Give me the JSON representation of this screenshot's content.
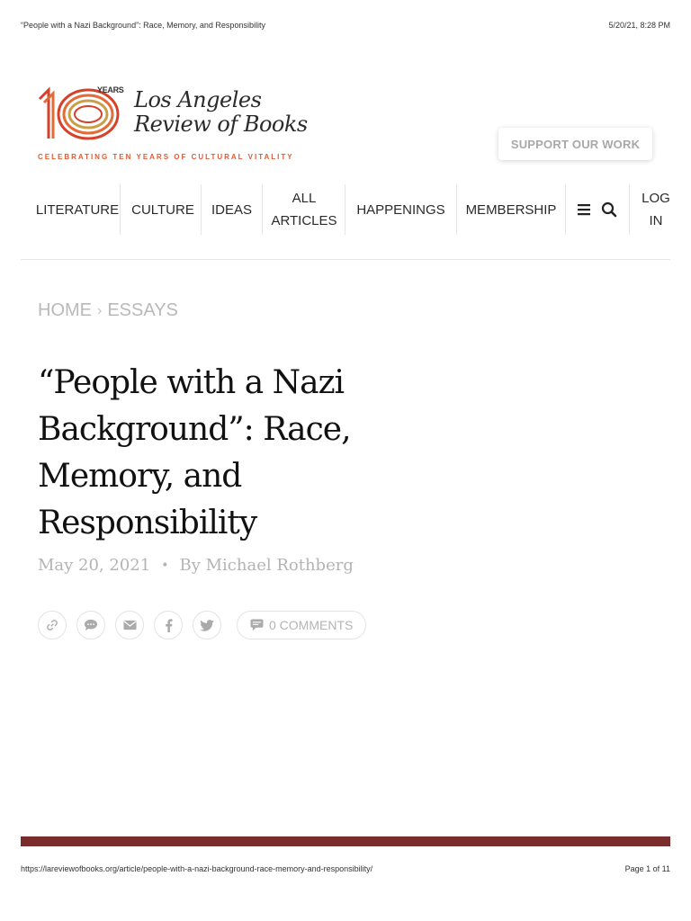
{
  "print_header": {
    "title": "“People with a Nazi Background”: Race, Memory, and Responsibility",
    "datetime": "5/20/21, 8:28 PM"
  },
  "logo": {
    "years_label": "YEARS",
    "name_line1": "Los Angeles",
    "name_line2": "Review of Books",
    "tagline": "CELEBRATING TEN YEARS OF CULTURAL VITALITY",
    "colors": {
      "red": "#d7402a",
      "orange": "#e26b36",
      "gold": "#c8a04a"
    }
  },
  "support_button": "SUPPORT OUR WORK",
  "nav": {
    "items": [
      {
        "label": "LITERATURE"
      },
      {
        "label": "CULTURE"
      },
      {
        "label": "IDEAS"
      },
      {
        "label": "ALL ARTICLES"
      },
      {
        "label": "HAPPENINGS"
      },
      {
        "label": "MEMBERSHIP"
      }
    ],
    "menu_icon": "hamburger-icon",
    "search_icon": "search-icon",
    "login_label": "LOG IN"
  },
  "breadcrumb": {
    "home": "HOME",
    "separator": "›",
    "section": "ESSAYS"
  },
  "article": {
    "title": "“People with a Nazi Background”: Race, Memory, and Responsibility",
    "date": "May 20, 2021",
    "bullet": "•",
    "byline": "By Michael Rothberg"
  },
  "share": {
    "icons": [
      "link-icon",
      "chat-icon",
      "email-icon",
      "facebook-icon",
      "twitter-icon"
    ],
    "comments_label": "0 COMMENTS"
  },
  "print_footer": {
    "url": "https://lareviewofbooks.org/article/people-with-a-nazi-background-race-memory-and-responsibility/",
    "page": "Page 1 of 11"
  },
  "colors": {
    "footer_bar": "#7a2b2b",
    "muted_text": "#b4b4b4"
  }
}
